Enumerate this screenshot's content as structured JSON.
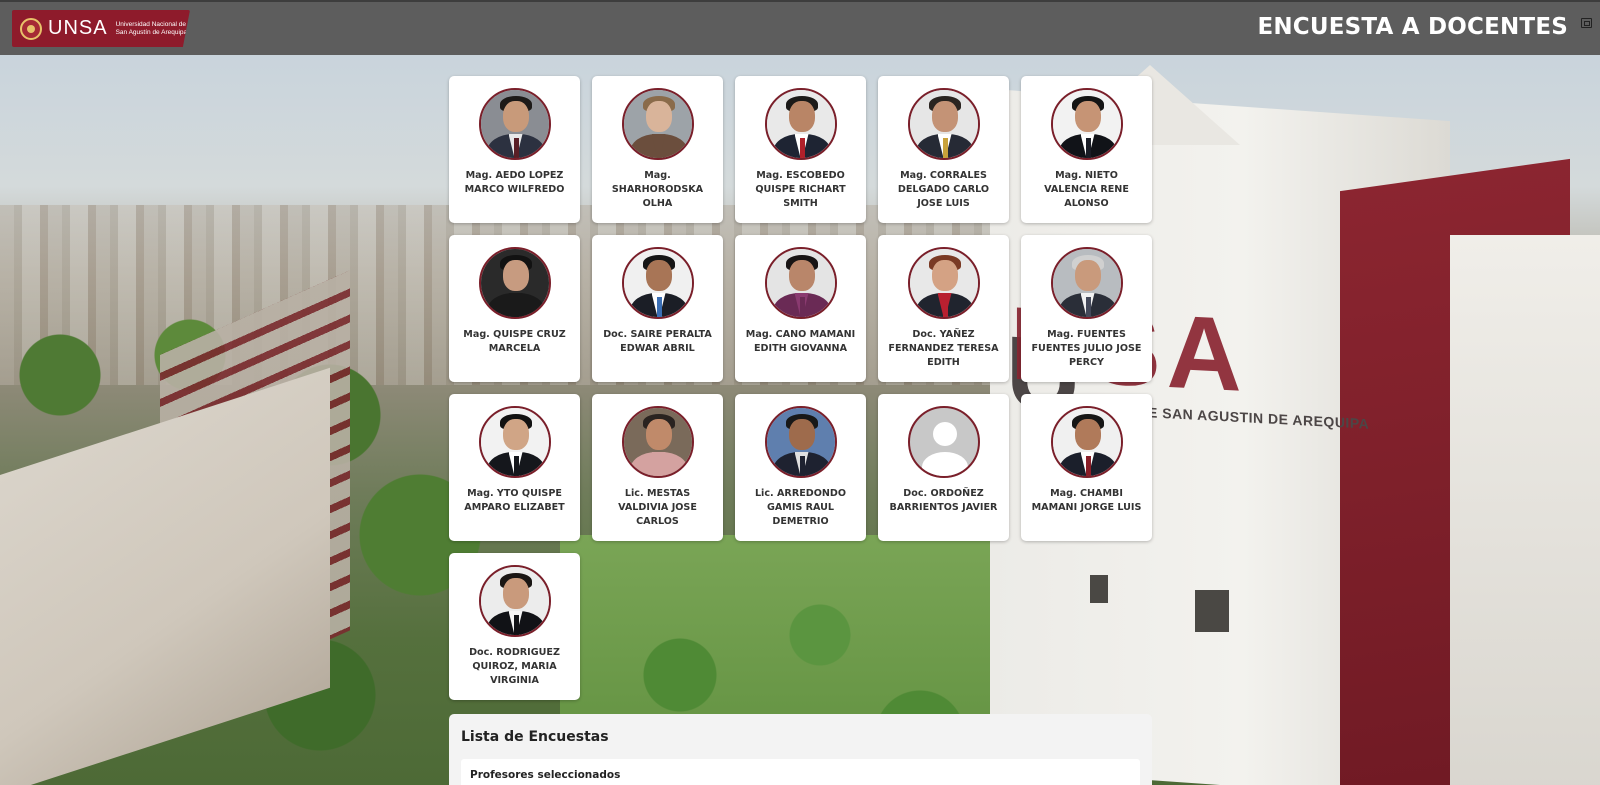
{
  "header": {
    "logo_word": "UNSA",
    "logo_sub": "Universidad Nacional de San Agustín de Arequipa",
    "title": "ENCUESTA A DOCENTES"
  },
  "background": {
    "sign": "NSA",
    "sign_sub": "E SAN AGUSTIN DE AREQUIPA"
  },
  "teachers": [
    {
      "name": "Mag. AEDO LOPEZ MARCO WILFREDO",
      "photo": {
        "bg": "#8a8d93",
        "skin": "#c89a7a",
        "hair": "#1d1a18",
        "body": "#2c3140",
        "shirt": "#e8e8e8",
        "tie": "#5a1f26"
      }
    },
    {
      "name": "Mag. SHARHORODSKA OLHA",
      "photo": {
        "bg": "#9da3a8",
        "skin": "#d9b49a",
        "hair": "#8a6b4a",
        "body": "#6b4e3d",
        "shirt": "#6b4e3d",
        "tie": "#6b4e3d"
      }
    },
    {
      "name": "Mag. ESCOBEDO QUISPE RICHART SMITH",
      "photo": {
        "bg": "#e9e9e9",
        "skin": "#b98566",
        "hair": "#1c1a18",
        "body": "#1e2433",
        "shirt": "#ffffff",
        "tie": "#b0202a"
      }
    },
    {
      "name": "Mag. CORRALES DELGADO CARLO JOSE LUIS",
      "photo": {
        "bg": "#e6e6e6",
        "skin": "#c49376",
        "hair": "#2a2420",
        "body": "#262a35",
        "shirt": "#ffffff",
        "tie": "#c9a23a"
      }
    },
    {
      "name": "Mag. NIETO VALENCIA RENE ALONSO",
      "photo": {
        "bg": "#f2f2f2",
        "skin": "#c69475",
        "hair": "#141414",
        "body": "#111318",
        "shirt": "#ffffff",
        "tie": "#1a1d26"
      }
    },
    {
      "name": "Mag. QUISPE CRUZ MARCELA",
      "photo": {
        "bg": "#2a2a2a",
        "skin": "#c79b80",
        "hair": "#121212",
        "body": "#1a1a1a",
        "shirt": "#1a1a1a",
        "tie": "#1a1a1a"
      }
    },
    {
      "name": "Doc. SAIRE PERALTA EDWAR ABRIL",
      "photo": {
        "bg": "#f0f0f0",
        "skin": "#a87556",
        "hair": "#161616",
        "body": "#1b1e26",
        "shirt": "#ffffff",
        "tie": "#3b6fb5"
      }
    },
    {
      "name": "Mag. CANO MAMANI EDITH GIOVANNA",
      "photo": {
        "bg": "#e4e4e4",
        "skin": "#b9866a",
        "hair": "#181414",
        "body": "#6a2a55",
        "shirt": "#8a3a70",
        "tie": "#6a2a55"
      }
    },
    {
      "name": "Doc. YAÑEZ FERNANDEZ TERESA EDITH",
      "photo": {
        "bg": "#e8e8e8",
        "skin": "#d4a284",
        "hair": "#7a3a24",
        "body": "#20242e",
        "shirt": "#b82030",
        "tie": "#b82030"
      }
    },
    {
      "name": "Mag. FUENTES FUENTES JULIO JOSE PERCY",
      "photo": {
        "bg": "#b8bcc0",
        "skin": "#c99a7c",
        "hair": "#d0d0d0",
        "body": "#2a2e38",
        "shirt": "#f2f2f2",
        "tie": "#44495a"
      }
    },
    {
      "name": "Mag. YTO QUISPE AMPARO ELIZABET",
      "photo": {
        "bg": "#f2f2f2",
        "skin": "#d0a586",
        "hair": "#121212",
        "body": "#15171c",
        "shirt": "#ffffff",
        "tie": "#15171c"
      }
    },
    {
      "name": "Lic. MESTAS VALDIVIA JOSE CARLOS",
      "photo": {
        "bg": "#7a6a5a",
        "skin": "#c08a6a",
        "hair": "#2a2320",
        "body": "#d4a2a0",
        "shirt": "#d4a2a0",
        "tie": "#d4a2a0"
      }
    },
    {
      "name": "Lic. ARREDONDO GAMIS RAUL DEMETRIO",
      "photo": {
        "bg": "#5f7fae",
        "skin": "#9e6b4c",
        "hair": "#181818",
        "body": "#1e2230",
        "shirt": "#e0e0e0",
        "tie": "#1e2230"
      }
    },
    {
      "name": "Doc. ORDOÑEZ BARRIENTOS JAVIER",
      "photo": {
        "bg": "#c8c8c8",
        "skin": "#ffffff",
        "hair": "#c8c8c8",
        "body": "#ffffff",
        "shirt": "#ffffff",
        "tie": "#ffffff"
      },
      "placeholder": true
    },
    {
      "name": "Mag. CHAMBI MAMANI JORGE LUIS",
      "photo": {
        "bg": "#f0f0f0",
        "skin": "#b07a5a",
        "hair": "#161616",
        "body": "#1b1f2b",
        "shirt": "#ffffff",
        "tie": "#8a1e28"
      }
    },
    {
      "name": "Doc. RODRIGUEZ QUIROZ, MARIA VIRGINIA",
      "photo": {
        "bg": "#ececec",
        "skin": "#c99a7c",
        "hair": "#1a1614",
        "body": "#111216",
        "shirt": "#f5f5f5",
        "tie": "#111216"
      }
    }
  ],
  "panel": {
    "title": "Lista de Encuestas",
    "subtitle": "Profesores seleccionados"
  },
  "colors": {
    "header_bg": "#5d5d5d",
    "brand": "#8e1b2b",
    "avatar_border": "#7a1f2a"
  }
}
